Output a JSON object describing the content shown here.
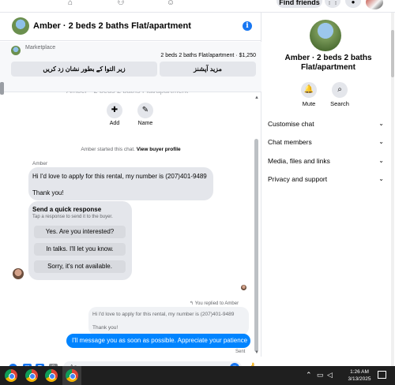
{
  "topnav": {
    "find_friends_label": "Find friends"
  },
  "chat": {
    "header": {
      "title": "Amber · 2 beds 2 baths Flat/apartment"
    },
    "marketplace": {
      "label": "Marketplace",
      "listing": "2 beds 2 baths Flat/apartment · $1,250",
      "buttons": [
        "مزید آپشنز",
        "زیر التوا کے بطور نشان زد کریں"
      ]
    },
    "actions": [
      {
        "label": "Add",
        "icon": "add-person-icon"
      },
      {
        "label": "Name",
        "icon": "pencil-icon"
      }
    ],
    "started_text": "Amber started this chat.",
    "view_profile_link": "View buyer profile",
    "sender_name": "Amber",
    "incoming_message": {
      "line1": "Hi I'd love to apply for this rental, my number is (207)401-9489",
      "line2": "Thank you!"
    },
    "quick_response": {
      "heading": "Send a quick response",
      "subtext": "Tap a response to send it to the buyer.",
      "options": [
        "Yes. Are you interested?",
        "In talks. I'll let you know.",
        "Sorry, it's not available."
      ]
    },
    "replied_label": "You replied to Amber",
    "quoted_message": {
      "line1": "Hi I'd love to apply for this rental, my number is (207)401-9489",
      "line2": "Thank you!"
    },
    "outgoing_message": "I'll message you as soon as possible. Appreciate your patience",
    "sent_status": "Sent",
    "composer": {
      "placeholder": "Aa"
    }
  },
  "info_panel": {
    "title": "Amber · 2 beds 2 baths Flat/apartment",
    "actions": [
      {
        "label": "Mute",
        "icon": "bell-icon"
      },
      {
        "label": "Search",
        "icon": "search-icon"
      }
    ],
    "sections": [
      "Customise chat",
      "Chat members",
      "Media, files and links",
      "Privacy and support"
    ]
  },
  "taskbar": {
    "time": "1:26 AM",
    "date": "3/13/2025"
  },
  "colors": {
    "accent": "#1877f2",
    "outgoing_bubble": "#0084ff",
    "incoming_bubble": "#e4e6eb",
    "taskbar": "#1f1f1f"
  }
}
